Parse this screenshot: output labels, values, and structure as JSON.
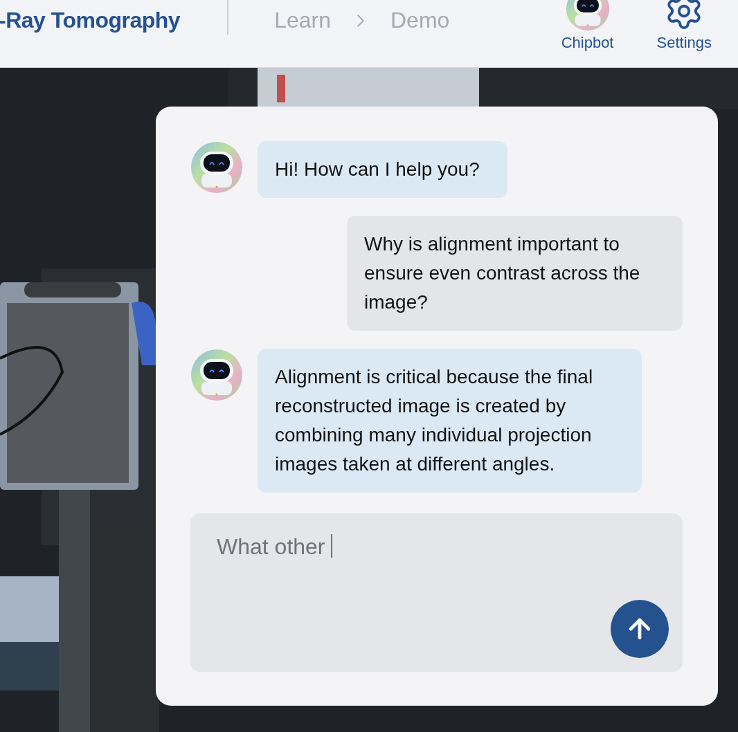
{
  "header": {
    "title": "-Ray Tomography",
    "breadcrumb": [
      "Learn",
      "Demo"
    ],
    "actions": [
      {
        "kind": "chipbot",
        "label": "Chipbot"
      },
      {
        "kind": "settings",
        "label": "Settings"
      }
    ]
  },
  "chat": {
    "messages": [
      {
        "kind": "bot",
        "text": "Hi! How can I help you?"
      },
      {
        "kind": "user",
        "text": "Why is alignment important to ensure even contrast across the image?"
      },
      {
        "kind": "bot",
        "text": "Alignment is critical because the final reconstructed image is created by combining many individual projection images taken at different angles."
      }
    ],
    "input": {
      "value": "What other"
    }
  }
}
